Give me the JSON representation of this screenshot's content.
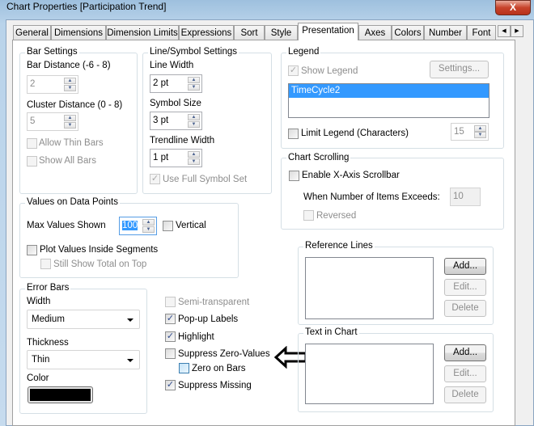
{
  "window": {
    "title": "Chart Properties [Participation Trend]",
    "close": "X"
  },
  "tabs": [
    {
      "label": "General"
    },
    {
      "label": "Dimensions"
    },
    {
      "label": "Dimension Limits"
    },
    {
      "label": "Expressions"
    },
    {
      "label": "Sort"
    },
    {
      "label": "Style"
    },
    {
      "label": "Presentation",
      "active": true
    },
    {
      "label": "Axes"
    },
    {
      "label": "Colors"
    },
    {
      "label": "Number"
    },
    {
      "label": "Font"
    }
  ],
  "tab_scroll": {
    "left": "◀",
    "right": "▶"
  },
  "bar_settings": {
    "title": "Bar Settings",
    "bar_distance_label": "Bar Distance (-6 - 8)",
    "bar_distance": "2",
    "cluster_distance_label": "Cluster Distance (0 - 8)",
    "cluster_distance": "5",
    "allow_thin_bars": "Allow Thin Bars",
    "show_all_bars": "Show All Bars"
  },
  "line_symbol": {
    "title": "Line/Symbol Settings",
    "line_width_label": "Line Width",
    "line_width": "2 pt",
    "symbol_size_label": "Symbol Size",
    "symbol_size": "3 pt",
    "trendline_width_label": "Trendline Width",
    "trendline_width": "1 pt",
    "use_full_symbol_set": "Use Full Symbol Set"
  },
  "values_on_data_points": {
    "title": "Values on Data Points",
    "max_values_label": "Max Values Shown",
    "max_values": "100",
    "vertical": "Vertical",
    "plot_inside": "Plot Values Inside Segments",
    "still_show_total": "Still Show Total on Top"
  },
  "legend": {
    "title": "Legend",
    "show_legend": "Show Legend",
    "settings_button": "Settings...",
    "items": [
      "TimeCycle2"
    ],
    "limit_legend": "Limit Legend (Characters)",
    "limit_value": "15"
  },
  "chart_scrolling": {
    "title": "Chart Scrolling",
    "enable_scrollbar": "Enable X-Axis Scrollbar",
    "when_exceeds_label": "When Number of Items Exceeds:",
    "when_exceeds": "10",
    "reversed": "Reversed"
  },
  "error_bars": {
    "title": "Error Bars",
    "width_label": "Width",
    "width": "Medium",
    "thickness_label": "Thickness",
    "thickness": "Thin",
    "color_label": "Color",
    "color": "#000000"
  },
  "options": {
    "semi_transparent": "Semi-transparent",
    "popup_labels": "Pop-up Labels",
    "highlight": "Highlight",
    "suppress_zero": "Suppress Zero-Values",
    "zero_on_bars": "Zero on Bars",
    "suppress_missing": "Suppress Missing"
  },
  "reference_lines": {
    "title": "Reference Lines",
    "add": "Add...",
    "edit": "Edit...",
    "delete": "Delete"
  },
  "text_in_chart": {
    "title": "Text in Chart",
    "add": "Add...",
    "edit": "Edit...",
    "delete": "Delete"
  },
  "check": "✓",
  "spin_up": "▲",
  "spin_down": "▼"
}
